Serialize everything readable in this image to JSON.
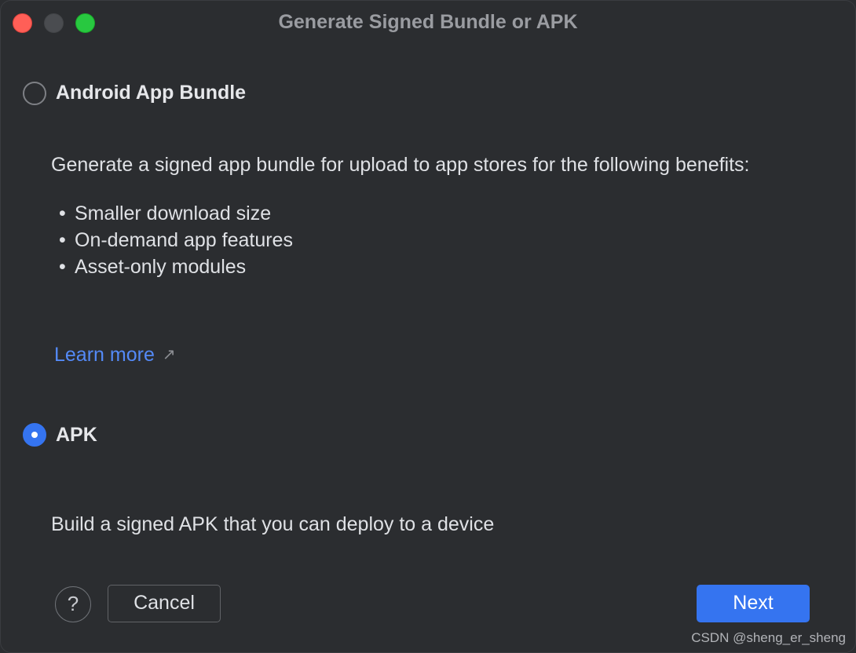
{
  "window": {
    "title": "Generate Signed Bundle or APK"
  },
  "options": {
    "bundle": {
      "label": "Android App Bundle",
      "selected": false,
      "description": "Generate a signed app bundle for upload to app stores for the following benefits:",
      "benefits": [
        "Smaller download size",
        "On-demand app features",
        "Asset-only modules"
      ],
      "learn_more": "Learn more",
      "learn_more_icon": "external-link-arrow-icon"
    },
    "apk": {
      "label": "APK",
      "selected": true,
      "description": "Build a signed APK that you can deploy to a device"
    }
  },
  "footer": {
    "help_label": "?",
    "cancel_label": "Cancel",
    "next_label": "Next"
  },
  "watermark": "CSDN @sheng_er_sheng",
  "colors": {
    "background": "#2b2d30",
    "accent": "#3574f0",
    "link": "#548af7",
    "close": "#ff5f57",
    "zoom": "#28c840"
  }
}
